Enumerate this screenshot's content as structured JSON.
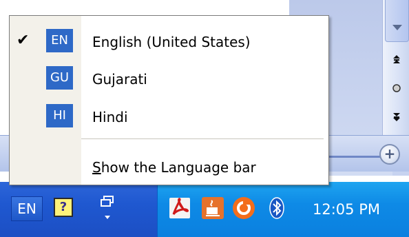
{
  "menu": {
    "items": [
      {
        "badge": "EN",
        "label": "English (United States)",
        "checked": true
      },
      {
        "badge": "GU",
        "label": "Gujarati",
        "checked": false
      },
      {
        "badge": "HI",
        "label": "Hindi",
        "checked": false
      }
    ],
    "show_bar_prefix": "S",
    "show_bar_rest": "how the Language bar"
  },
  "taskbar": {
    "lang_button": "EN",
    "help_icon": "help-icon",
    "restore_icon": "restore-down-icon",
    "tray_icons": [
      "acrobat-icon",
      "java-icon",
      "swirl-icon",
      "bluetooth-icon"
    ],
    "clock": "12:05 PM"
  },
  "colors": {
    "taskbar": "#1f58d0",
    "tray": "#0e8ae6",
    "badge": "#2e69c7",
    "menu_gutter": "#f3f1ea"
  }
}
